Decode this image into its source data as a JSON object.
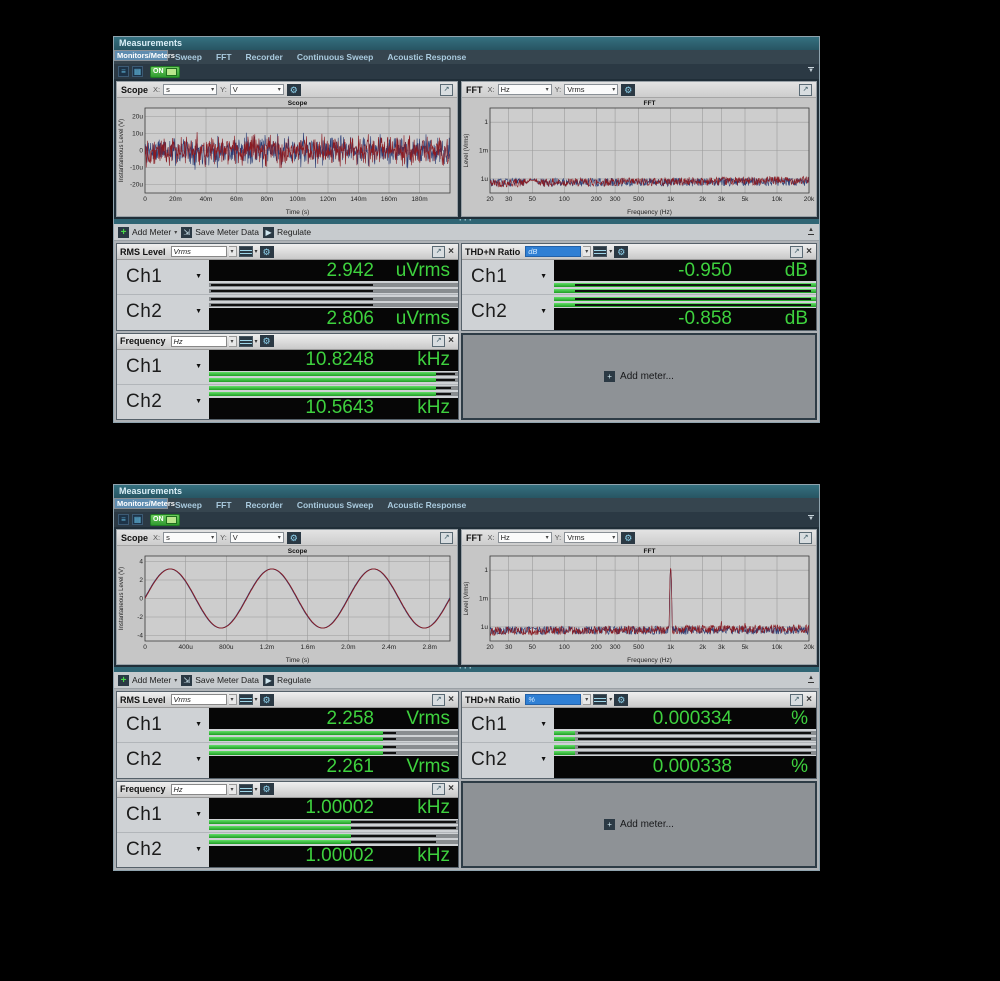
{
  "colors": {
    "accent_green": "#3ed13e",
    "bar_green": "#2eb82e",
    "series_blue": "#2c3e76",
    "series_red": "#8a1b22",
    "selected_tab": "#5e8cb0",
    "title_teal": "#2d6271"
  },
  "chrome": {
    "window_title": "Measurements",
    "tabs": [
      {
        "label": "Monitors/Meters",
        "selected": true
      },
      {
        "label": "Sweep",
        "selected": false
      },
      {
        "label": "FFT",
        "selected": false
      },
      {
        "label": "Recorder",
        "selected": false
      },
      {
        "label": "Continuous Sweep",
        "selected": false
      },
      {
        "label": "Acoustic Response",
        "selected": false
      }
    ],
    "toolbar": {
      "on_label": "ON"
    },
    "meter_toolbar": {
      "add_meter": "Add Meter",
      "save": "Save Meter Data",
      "regulate": "Regulate"
    },
    "add_meter_placeholder": "Add meter...",
    "x_label": "X:",
    "y_label": "Y:"
  },
  "panels": [
    {
      "scope": {
        "title": "Scope",
        "x_unit": "s",
        "y_unit": "V",
        "chart": {
          "type": "line",
          "title": "Scope",
          "xlabel": "Time (s)",
          "ylabel": "Instantaneous Level (V)",
          "x_scale": "linear",
          "x_min": 0,
          "x_max": 0.2,
          "x_ticks": [
            {
              "v": 0,
              "l": "0"
            },
            {
              "v": 0.02,
              "l": "20m"
            },
            {
              "v": 0.04,
              "l": "40m"
            },
            {
              "v": 0.06,
              "l": "60m"
            },
            {
              "v": 0.08,
              "l": "80m"
            },
            {
              "v": 0.1,
              "l": "100m"
            },
            {
              "v": 0.12,
              "l": "120m"
            },
            {
              "v": 0.14,
              "l": "140m"
            },
            {
              "v": 0.16,
              "l": "160m"
            },
            {
              "v": 0.18,
              "l": "180m"
            }
          ],
          "y_scale": "linear",
          "y_min": -2.5e-05,
          "y_max": 2.5e-05,
          "y_ticks": [
            {
              "v": 2e-05,
              "l": "20u"
            },
            {
              "v": 1e-05,
              "l": "10u"
            },
            {
              "v": 0,
              "l": "0"
            },
            {
              "v": -1e-05,
              "l": "-10u"
            },
            {
              "v": -2e-05,
              "l": "-20u"
            }
          ],
          "series": [
            {
              "name": "Ch1",
              "color": "#2c3e76",
              "gen": "noise",
              "rms": 4e-06,
              "peak": 1.35e-05,
              "seed": 11
            },
            {
              "name": "Ch2",
              "color": "#8a1b22",
              "gen": "noise",
              "rms": 4e-06,
              "peak": 1.25e-05,
              "seed": 22
            }
          ]
        }
      },
      "fft": {
        "title": "FFT",
        "x_unit": "Hz",
        "y_unit": "Vrms",
        "chart": {
          "type": "line",
          "title": "FFT",
          "xlabel": "Frequency (Hz)",
          "ylabel": "Level (Vrms)",
          "x_scale": "log",
          "x_min": 20,
          "x_max": 20000,
          "x_ticks": [
            {
              "v": 20,
              "l": "20"
            },
            {
              "v": 30,
              "l": "30"
            },
            {
              "v": 50,
              "l": "50"
            },
            {
              "v": 100,
              "l": "100"
            },
            {
              "v": 200,
              "l": "200"
            },
            {
              "v": 300,
              "l": "300"
            },
            {
              "v": 500,
              "l": "500"
            },
            {
              "v": 1000,
              "l": "1k"
            },
            {
              "v": 2000,
              "l": "2k"
            },
            {
              "v": 3000,
              "l": "3k"
            },
            {
              "v": 5000,
              "l": "5k"
            },
            {
              "v": 10000,
              "l": "10k"
            },
            {
              "v": 20000,
              "l": "20k"
            }
          ],
          "y_scale": "log",
          "y_min": 3.2e-08,
          "y_max": 31.6,
          "y_ticks": [
            {
              "v": 1,
              "l": "1"
            },
            {
              "v": 0.001,
              "l": "1m"
            },
            {
              "v": 1e-06,
              "l": "1u"
            }
          ],
          "series": [
            {
              "name": "Ch1",
              "color": "#2c3e76",
              "gen": "fft",
              "floor": 4.2e-07,
              "floor2": 5e-07,
              "seed": 31,
              "peaks": [
                {
                  "f": 50,
                  "v": 9e-07,
                  "w": 0.08
                }
              ]
            },
            {
              "name": "Ch2",
              "color": "#8a1b22",
              "gen": "fft",
              "floor": 3.6e-07,
              "floor2": 7e-07,
              "seed": 42,
              "peaks": [
                {
                  "f": 50,
                  "v": 6.5e-07,
                  "w": 0.1
                }
              ]
            }
          ]
        }
      },
      "meters": {
        "rms": {
          "title": "RMS Level",
          "unit": "Vrms",
          "channels": [
            {
              "label": "Ch1",
              "value": "2.942",
              "unit": "uVrms",
              "fill": 0,
              "hold_from": 1,
              "hold_to": 66
            },
            {
              "label": "Ch2",
              "value": "2.806",
              "unit": "uVrms",
              "fill": 0,
              "hold_from": 1,
              "hold_to": 66
            }
          ]
        },
        "thdn": {
          "title": "THD+N Ratio",
          "unit": "dB",
          "channels": [
            {
              "label": "Ch1",
              "value": "-0.950",
              "unit": "dB",
              "fill": 100,
              "hold_from": 8,
              "hold_to": 98
            },
            {
              "label": "Ch2",
              "value": "-0.858",
              "unit": "dB",
              "fill": 100,
              "hold_from": 8,
              "hold_to": 98
            }
          ]
        },
        "freq": {
          "title": "Frequency",
          "unit": "Hz",
          "channels": [
            {
              "label": "Ch1",
              "value": "10.8248",
              "unit": "kHz",
              "fill": 91,
              "hold_from": 91,
              "hold_to": 99
            },
            {
              "label": "Ch2",
              "value": "10.5643",
              "unit": "kHz",
              "fill": 91,
              "hold_from": 91,
              "hold_to": 97
            }
          ]
        }
      }
    },
    {
      "scope": {
        "title": "Scope",
        "x_unit": "s",
        "y_unit": "V",
        "chart": {
          "type": "line",
          "title": "Scope",
          "xlabel": "Time (s)",
          "ylabel": "Instantaneous Level (V)",
          "x_scale": "linear",
          "x_min": 0,
          "x_max": 0.003,
          "x_ticks": [
            {
              "v": 0,
              "l": "0"
            },
            {
              "v": 0.0004,
              "l": "400u"
            },
            {
              "v": 0.0008,
              "l": "800u"
            },
            {
              "v": 0.0012,
              "l": "1.2m"
            },
            {
              "v": 0.0016,
              "l": "1.6m"
            },
            {
              "v": 0.002,
              "l": "2.0m"
            },
            {
              "v": 0.0024,
              "l": "2.4m"
            },
            {
              "v": 0.0028,
              "l": "2.8m"
            }
          ],
          "y_scale": "linear",
          "y_min": -4.6,
          "y_max": 4.6,
          "y_ticks": [
            {
              "v": 4,
              "l": "4"
            },
            {
              "v": 2,
              "l": "2"
            },
            {
              "v": 0,
              "l": "0"
            },
            {
              "v": -2,
              "l": "-2"
            },
            {
              "v": -4,
              "l": "-4"
            }
          ],
          "series": [
            {
              "name": "Ch1",
              "color": "#2c3e76",
              "gen": "sine",
              "freq": 1000,
              "amp": 3.2,
              "phase": 0.03
            },
            {
              "name": "Ch2",
              "color": "#8a1b22",
              "gen": "sine",
              "freq": 1000,
              "amp": 3.2,
              "phase": 0
            }
          ]
        }
      },
      "fft": {
        "title": "FFT",
        "x_unit": "Hz",
        "y_unit": "Vrms",
        "chart": {
          "type": "line",
          "title": "FFT",
          "xlabel": "Frequency (Hz)",
          "ylabel": "Level (Vrms)",
          "x_scale": "log",
          "x_min": 20,
          "x_max": 20000,
          "x_ticks": [
            {
              "v": 20,
              "l": "20"
            },
            {
              "v": 30,
              "l": "30"
            },
            {
              "v": 50,
              "l": "50"
            },
            {
              "v": 100,
              "l": "100"
            },
            {
              "v": 200,
              "l": "200"
            },
            {
              "v": 300,
              "l": "300"
            },
            {
              "v": 500,
              "l": "500"
            },
            {
              "v": 1000,
              "l": "1k"
            },
            {
              "v": 2000,
              "l": "2k"
            },
            {
              "v": 3000,
              "l": "3k"
            },
            {
              "v": 5000,
              "l": "5k"
            },
            {
              "v": 10000,
              "l": "10k"
            },
            {
              "v": 20000,
              "l": "20k"
            }
          ],
          "y_scale": "log",
          "y_min": 3.2e-08,
          "y_max": 31.6,
          "y_ticks": [
            {
              "v": 1,
              "l": "1"
            },
            {
              "v": 0.001,
              "l": "1m"
            },
            {
              "v": 1e-06,
              "l": "1u"
            }
          ],
          "series": [
            {
              "name": "Ch1",
              "color": "#2c3e76",
              "gen": "fft",
              "floor": 4.2e-07,
              "floor2": 4.5e-07,
              "seed": 55,
              "peaks": [
                {
                  "f": 50,
                  "v": 8e-07,
                  "w": 0.07
                },
                {
                  "f": 1000,
                  "v": 1.3
                }
              ]
            },
            {
              "name": "Ch2",
              "color": "#8a1b22",
              "gen": "fft",
              "floor": 3.6e-07,
              "floor2": 6.5e-07,
              "seed": 66,
              "peaks": [
                {
                  "f": 1000,
                  "v": 1.6
                },
                {
                  "f": 2000,
                  "v": 1.5e-06
                },
                {
                  "f": 3000,
                  "v": 4e-06
                },
                {
                  "f": 5000,
                  "v": 2.5e-06
                }
              ]
            }
          ]
        }
      },
      "meters": {
        "rms": {
          "title": "RMS Level",
          "unit": "Vrms",
          "channels": [
            {
              "label": "Ch1",
              "value": "2.258",
              "unit": "Vrms",
              "fill": 70,
              "hold_from": 70,
              "hold_to": 75
            },
            {
              "label": "Ch2",
              "value": "2.261",
              "unit": "Vrms",
              "fill": 70,
              "hold_from": 70,
              "hold_to": 75
            }
          ]
        },
        "thdn": {
          "title": "THD+N Ratio",
          "unit": "%",
          "channels": [
            {
              "label": "Ch1",
              "value": "0.000334",
              "unit": "%",
              "fill": 8,
              "hold_from": 9,
              "hold_to": 98
            },
            {
              "label": "Ch2",
              "value": "0.000338",
              "unit": "%",
              "fill": 8,
              "hold_from": 9,
              "hold_to": 98
            }
          ]
        },
        "freq": {
          "title": "Frequency",
          "unit": "Hz",
          "channels": [
            {
              "label": "Ch1",
              "value": "1.00002",
              "unit": "kHz",
              "fill": 57,
              "hold_from": 57,
              "hold_to": 99
            },
            {
              "label": "Ch2",
              "value": "1.00002",
              "unit": "kHz",
              "fill": 57,
              "hold_from": 57,
              "hold_to": 91
            }
          ]
        }
      }
    }
  ]
}
